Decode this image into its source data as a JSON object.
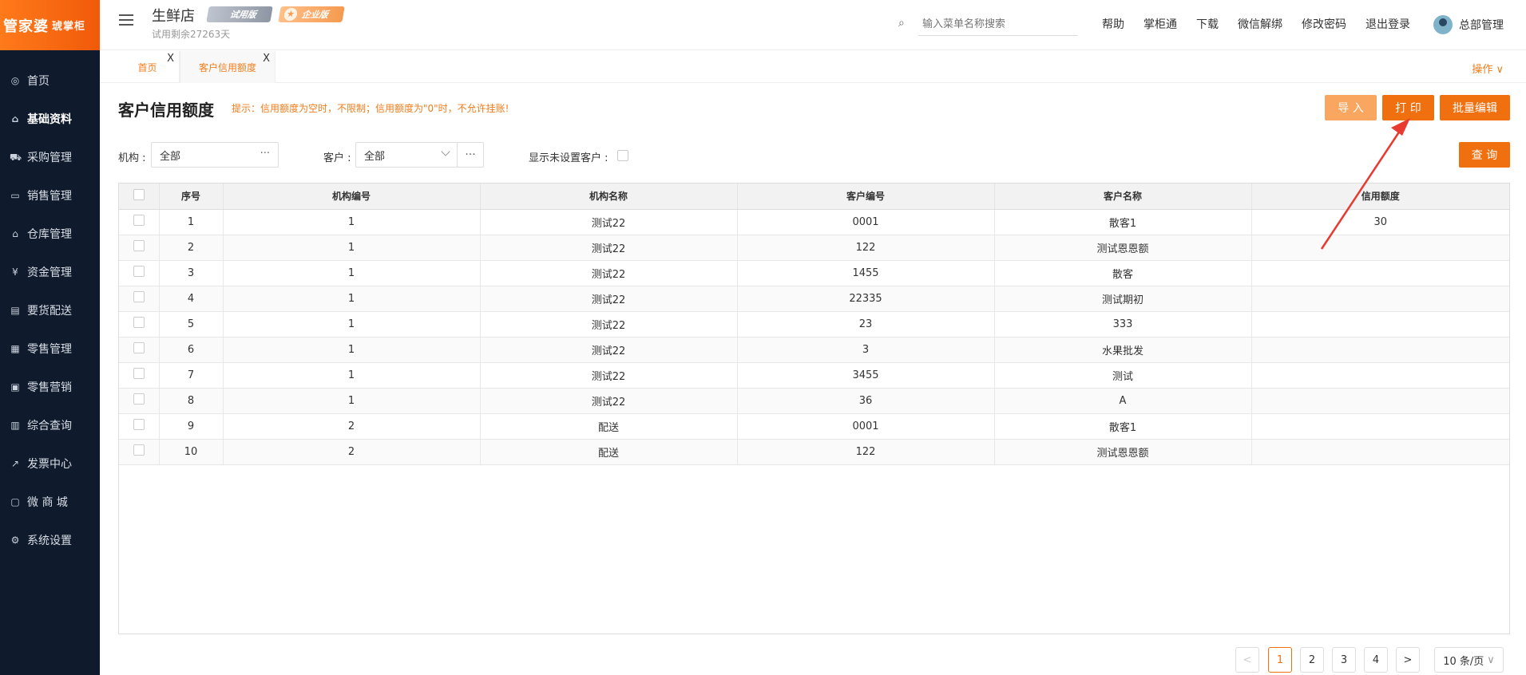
{
  "brand": {
    "logo_main": "管家婆",
    "logo_sub": "琥掌柜"
  },
  "sidebar": {
    "items": [
      {
        "label": "首页",
        "icon": "globe-icon"
      },
      {
        "label": "基础资料",
        "icon": "home-icon",
        "active": true
      },
      {
        "label": "采购管理",
        "icon": "cart-icon"
      },
      {
        "label": "销售管理",
        "icon": "card-icon"
      },
      {
        "label": "仓库管理",
        "icon": "bank-icon"
      },
      {
        "label": "资金管理",
        "icon": "money-icon"
      },
      {
        "label": "要货配送",
        "icon": "list-icon"
      },
      {
        "label": "零售管理",
        "icon": "chart-icon"
      },
      {
        "label": "零售营销",
        "icon": "gift-icon"
      },
      {
        "label": "综合查询",
        "icon": "bar-icon"
      },
      {
        "label": "发票中心",
        "icon": "invoice-icon"
      },
      {
        "label": "微 商 城",
        "icon": "bag-icon"
      },
      {
        "label": "系统设置",
        "icon": "gear-icon"
      }
    ]
  },
  "header": {
    "shop_name": "生鲜店",
    "trial_badge": "试用版",
    "enterprise_badge": "企业版",
    "trial_remaining": "试用剩余27263天",
    "search_placeholder": "输入菜单名称搜索",
    "links": [
      "帮助",
      "掌柜通",
      "下载",
      "微信解绑",
      "修改密码",
      "退出登录"
    ],
    "user_name": "总部管理"
  },
  "tabs": {
    "home": "首页",
    "credit": "客户信用额度",
    "close": "X",
    "ops": "操作 ∨"
  },
  "main": {
    "title": "客户信用额度",
    "hint": "提示：信用额度为空时，不限制；信用额度为\"0\"时，不允许挂账!",
    "buttons": {
      "import": "导 入",
      "print": "打 印",
      "batch_edit": "批量编辑",
      "query": "查 询"
    },
    "filters": {
      "org_label": "机构 :",
      "org_value": "全部",
      "customer_label": "客户 :",
      "customer_value": "全部",
      "show_unset_label": "显示未设置客户 :"
    }
  },
  "table": {
    "columns": [
      "序号",
      "机构编号",
      "机构名称",
      "客户编号",
      "客户名称",
      "信用额度"
    ],
    "rows": [
      [
        "1",
        "1",
        "测试22",
        "0001",
        "散客1",
        "30"
      ],
      [
        "2",
        "1",
        "测试22",
        "122",
        "测试恩恩额",
        ""
      ],
      [
        "3",
        "1",
        "测试22",
        "1455",
        "散客",
        ""
      ],
      [
        "4",
        "1",
        "测试22",
        "22335",
        "测试期初",
        ""
      ],
      [
        "5",
        "1",
        "测试22",
        "23",
        "333",
        ""
      ],
      [
        "6",
        "1",
        "测试22",
        "3",
        "水果批发",
        ""
      ],
      [
        "7",
        "1",
        "测试22",
        "3455",
        "测试",
        ""
      ],
      [
        "8",
        "1",
        "测试22",
        "36",
        "A",
        ""
      ],
      [
        "9",
        "2",
        "配送",
        "0001",
        "散客1",
        ""
      ],
      [
        "10",
        "2",
        "配送",
        "122",
        "测试恩恩额",
        ""
      ]
    ]
  },
  "pagination": {
    "prev": "<",
    "pages": [
      "1",
      "2",
      "3",
      "4"
    ],
    "current": "1",
    "next": ">",
    "page_size": "10 条/页"
  },
  "colors": {
    "accent": "#f06f0f",
    "sidebar_bg": "#0f1b2d",
    "annotation": "#e83a30"
  }
}
